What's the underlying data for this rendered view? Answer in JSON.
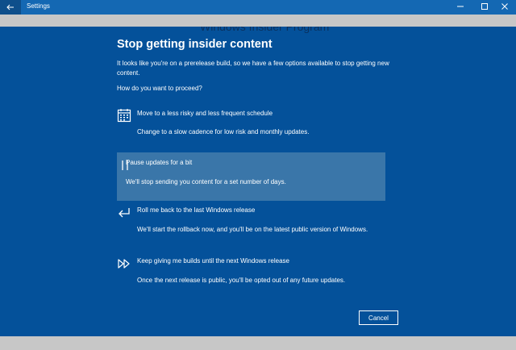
{
  "window": {
    "title": "Settings",
    "back_icon": "back-arrow-icon",
    "min_icon": "minimize-icon",
    "max_icon": "maximize-icon",
    "close_icon": "close-icon"
  },
  "background": {
    "ghost_title": "Windows Insider Program"
  },
  "dialog": {
    "title": "Stop getting insider content",
    "intro": "It looks like you're on a prerelease build, so we have a few options available to stop getting new content.",
    "question": "How do you want to proceed?",
    "options": [
      {
        "icon": "calendar-icon",
        "title": "Move to a less risky and less frequent schedule",
        "description": "Change to a slow cadence for low risk and monthly updates.",
        "selected": false
      },
      {
        "icon": "pause-icon",
        "title": "Pause updates for a bit",
        "description": "We'll stop sending you content for a set number of days.",
        "selected": true
      },
      {
        "icon": "rollback-arrow-icon",
        "title": "Roll me back to the last Windows release",
        "description": "We'll start the rollback now, and you'll be on the latest public version of Windows.",
        "selected": false
      },
      {
        "icon": "fast-forward-icon",
        "title": "Keep giving me builds until the next Windows release",
        "description": "Once the next release is public, you'll be opted out of any future updates.",
        "selected": false
      }
    ],
    "cancel_label": "Cancel"
  },
  "colors": {
    "titlebar": "#1468b3",
    "dialog_bg": "#04519a",
    "selected_option": "#3a76a9",
    "text": "#ffffff"
  }
}
